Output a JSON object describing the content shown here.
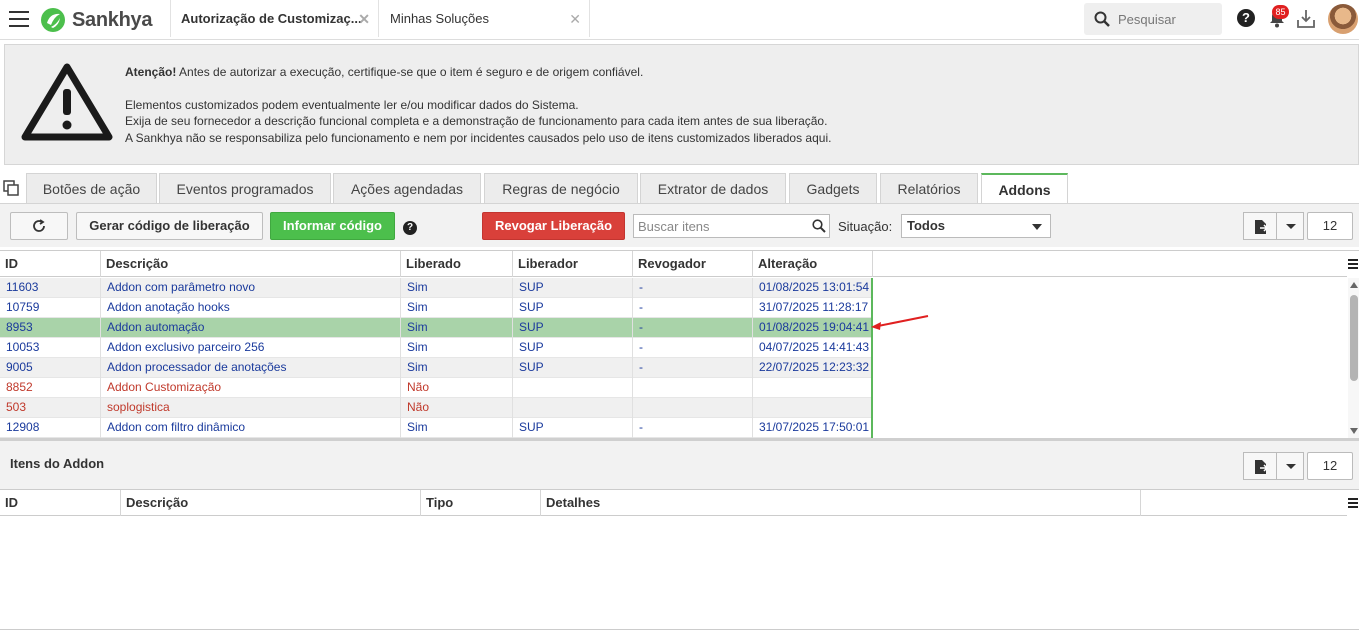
{
  "topbar": {
    "brand": "Sankhya",
    "tabs": [
      {
        "label": "Autorização de Customizaç...",
        "close": "✕"
      },
      {
        "label": "Minhas Soluções",
        "close": "✕"
      }
    ],
    "search_label": "Pesquisar",
    "help": "?",
    "notifications_count": "85"
  },
  "warning": {
    "strong": "Atenção!",
    "line1": " Antes de autorizar a execução, certifique-se que o item é seguro e de origem confiável.",
    "line2": "Elementos customizados podem eventualmente ler e/ou modificar dados do Sistema.",
    "line3": "Exija de seu fornecedor a descrição funcional completa e a demonstração de funcionamento para cada item antes de sua liberação.",
    "line4": "A Sankhya não se responsabiliza pelo funcionamento e nem por incidentes causados pelo uso de itens customizados liberados aqui."
  },
  "tabs": [
    "Botões de ação",
    "Eventos programados",
    "Ações agendadas",
    "Regras de negócio",
    "Extrator de dados",
    "Gadgets",
    "Relatórios",
    "Addons"
  ],
  "active_tab": "Addons",
  "toolbar": {
    "gerar": "Gerar código de liberação",
    "informar": "Informar código",
    "revogar": "Revogar Liberação",
    "search_placeholder": "Buscar itens",
    "situacao_label": "Situação:",
    "situacao_value": "Todos",
    "count": "12"
  },
  "grid": {
    "columns": [
      "ID",
      "Descrição",
      "Liberado",
      "Liberador",
      "Revogador",
      "Alteração"
    ],
    "rows": [
      {
        "id": "11603",
        "desc": "Addon com parâmetro novo",
        "lib": "Sim",
        "libr": "SUP",
        "rev": "-",
        "alt": "01/08/2025 13:01:54"
      },
      {
        "id": "10759",
        "desc": "Addon anotação hooks",
        "lib": "Sim",
        "libr": "SUP",
        "rev": "-",
        "alt": "31/07/2025 11:28:17"
      },
      {
        "id": "8953",
        "desc": "Addon automação",
        "lib": "Sim",
        "libr": "SUP",
        "rev": "-",
        "alt": "01/08/2025 19:04:41"
      },
      {
        "id": "10053",
        "desc": "Addon exclusivo parceiro 256",
        "lib": "Sim",
        "libr": "SUP",
        "rev": "-",
        "alt": "04/07/2025 14:41:43"
      },
      {
        "id": "9005",
        "desc": "Addon processador de anotações",
        "lib": "Sim",
        "libr": "SUP",
        "rev": "-",
        "alt": "22/07/2025 12:23:32"
      },
      {
        "id": "8852",
        "desc": "Addon Customização",
        "lib": "Não",
        "libr": "",
        "rev": "",
        "alt": ""
      },
      {
        "id": "503",
        "desc": "soplogistica",
        "lib": "Não",
        "libr": "",
        "rev": "",
        "alt": ""
      },
      {
        "id": "12908",
        "desc": "Addon com filtro dinâmico",
        "lib": "Sim",
        "libr": "SUP",
        "rev": "-",
        "alt": "31/07/2025 17:50:01"
      }
    ]
  },
  "bottom": {
    "title": "Itens do Addon",
    "count": "12",
    "columns": [
      "ID",
      "Descrição",
      "Tipo",
      "Detalhes"
    ]
  },
  "colors": {
    "accent_green": "#4cbf4c",
    "danger_red": "#d9403a",
    "selected_row": "#a9d3a9",
    "link_blue": "#1a3a9c",
    "annotation_arrow": "#e02020"
  }
}
